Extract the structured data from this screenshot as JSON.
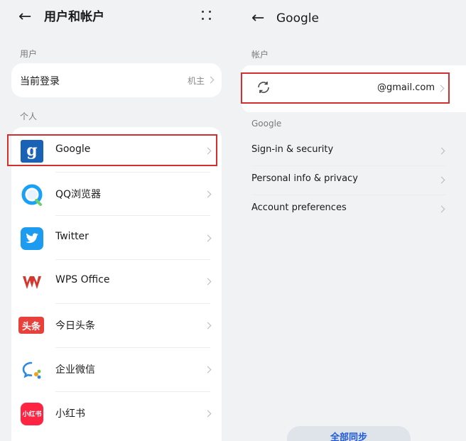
{
  "left": {
    "title": "用户和帐户",
    "user_section": "用户",
    "current_login": {
      "label": "当前登录",
      "value": "机主"
    },
    "personal_section": "个人",
    "accounts": [
      {
        "label": "Google",
        "icon": "google-icon"
      },
      {
        "label": "QQ浏览器",
        "icon": "qq-browser-icon"
      },
      {
        "label": "Twitter",
        "icon": "twitter-icon"
      },
      {
        "label": "WPS Office",
        "icon": "wps-office-icon"
      },
      {
        "label": "今日头条",
        "icon": "toutiao-icon",
        "icon_text": "头条"
      },
      {
        "label": "企业微信",
        "icon": "wecom-icon"
      },
      {
        "label": "小红书",
        "icon": "xiaohongshu-icon",
        "icon_text": "小红书"
      }
    ]
  },
  "right": {
    "title": "Google",
    "account_section": "帐户",
    "email": "@gmail.com",
    "google_section": "Google",
    "items": [
      {
        "label": "Sign-in & security"
      },
      {
        "label": "Personal info & privacy"
      },
      {
        "label": "Account preferences"
      }
    ],
    "sync_button": "全部同步"
  },
  "colors": {
    "highlight": "#d32f2f",
    "google_tile": "#1a62b5",
    "twitter": "#1d9bf0",
    "wps": "#d4372d",
    "toutiao": "#e8413c",
    "xiaohongshu": "#ff2442",
    "sync_text": "#1e5bd8"
  }
}
